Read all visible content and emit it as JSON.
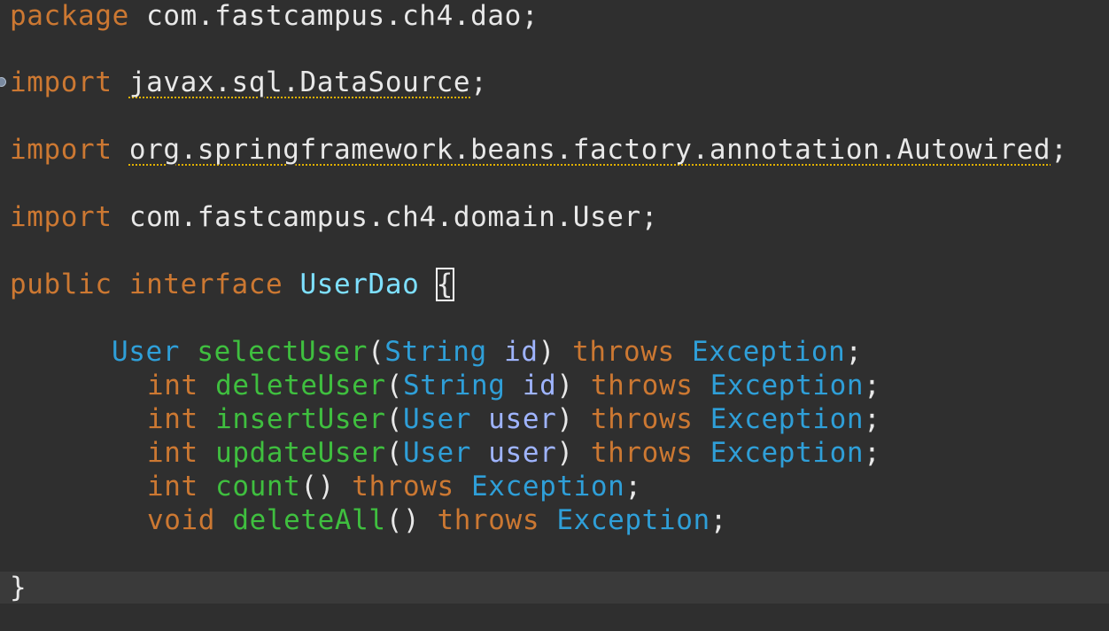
{
  "code": {
    "lines": [
      [
        {
          "text": "package",
          "style": "kw"
        },
        {
          "text": " com.fastcampus.ch4.dao;",
          "style": "plain"
        }
      ],
      [
        {
          "text": "import",
          "style": "kw"
        },
        {
          "text": " ",
          "style": "plain"
        },
        {
          "text": "javax.sql.DataSource",
          "style": "unused"
        },
        {
          "text": ";",
          "style": "plain"
        }
      ],
      [
        {
          "text": "import",
          "style": "kw"
        },
        {
          "text": " ",
          "style": "plain"
        },
        {
          "text": "org.springframework.beans.factory.annotation.Autowired",
          "style": "unused"
        },
        {
          "text": ";",
          "style": "plain"
        }
      ],
      [
        {
          "text": "import",
          "style": "kw"
        },
        {
          "text": " com.fastcampus.ch4.domain.User;",
          "style": "plain"
        }
      ],
      [
        {
          "text": "public",
          "style": "kw"
        },
        {
          "text": " ",
          "style": "plain"
        },
        {
          "text": "interface",
          "style": "kw"
        },
        {
          "text": " ",
          "style": "plain"
        },
        {
          "text": "UserDao",
          "style": "cls"
        },
        {
          "text": " ",
          "style": "plain"
        },
        {
          "text": "{",
          "style": "brace-box"
        }
      ],
      [
        {
          "text": "User",
          "style": "type"
        },
        {
          "text": " ",
          "style": "plain"
        },
        {
          "text": "selectUser",
          "style": "method"
        },
        {
          "text": "(",
          "style": "plain"
        },
        {
          "text": "String",
          "style": "type"
        },
        {
          "text": " ",
          "style": "plain"
        },
        {
          "text": "id",
          "style": "param"
        },
        {
          "text": ") ",
          "style": "plain"
        },
        {
          "text": "throws",
          "style": "kw"
        },
        {
          "text": " ",
          "style": "plain"
        },
        {
          "text": "Exception",
          "style": "type"
        },
        {
          "text": ";",
          "style": "plain"
        }
      ],
      [
        {
          "text": "int",
          "style": "kw"
        },
        {
          "text": " ",
          "style": "plain"
        },
        {
          "text": "deleteUser",
          "style": "method"
        },
        {
          "text": "(",
          "style": "plain"
        },
        {
          "text": "String",
          "style": "type"
        },
        {
          "text": " ",
          "style": "plain"
        },
        {
          "text": "id",
          "style": "param"
        },
        {
          "text": ") ",
          "style": "plain"
        },
        {
          "text": "throws",
          "style": "kw"
        },
        {
          "text": " ",
          "style": "plain"
        },
        {
          "text": "Exception",
          "style": "type"
        },
        {
          "text": ";",
          "style": "plain"
        }
      ],
      [
        {
          "text": "int",
          "style": "kw"
        },
        {
          "text": " ",
          "style": "plain"
        },
        {
          "text": "insertUser",
          "style": "method"
        },
        {
          "text": "(",
          "style": "plain"
        },
        {
          "text": "User",
          "style": "type"
        },
        {
          "text": " ",
          "style": "plain"
        },
        {
          "text": "user",
          "style": "param"
        },
        {
          "text": ") ",
          "style": "plain"
        },
        {
          "text": "throws",
          "style": "kw"
        },
        {
          "text": " ",
          "style": "plain"
        },
        {
          "text": "Exception",
          "style": "type"
        },
        {
          "text": ";",
          "style": "plain"
        }
      ],
      [
        {
          "text": "int",
          "style": "kw"
        },
        {
          "text": " ",
          "style": "plain"
        },
        {
          "text": "updateUser",
          "style": "method"
        },
        {
          "text": "(",
          "style": "plain"
        },
        {
          "text": "User",
          "style": "type"
        },
        {
          "text": " ",
          "style": "plain"
        },
        {
          "text": "user",
          "style": "param"
        },
        {
          "text": ") ",
          "style": "plain"
        },
        {
          "text": "throws",
          "style": "kw"
        },
        {
          "text": " ",
          "style": "plain"
        },
        {
          "text": "Exception",
          "style": "type"
        },
        {
          "text": ";",
          "style": "plain"
        }
      ],
      [
        {
          "text": "int",
          "style": "kw"
        },
        {
          "text": " ",
          "style": "plain"
        },
        {
          "text": "count",
          "style": "method"
        },
        {
          "text": "() ",
          "style": "plain"
        },
        {
          "text": "throws",
          "style": "kw"
        },
        {
          "text": " ",
          "style": "plain"
        },
        {
          "text": "Exception",
          "style": "type"
        },
        {
          "text": ";",
          "style": "plain"
        }
      ],
      [
        {
          "text": "void",
          "style": "kw"
        },
        {
          "text": " ",
          "style": "plain"
        },
        {
          "text": "deleteAll",
          "style": "method"
        },
        {
          "text": "() ",
          "style": "plain"
        },
        {
          "text": "throws",
          "style": "kw"
        },
        {
          "text": " ",
          "style": "plain"
        },
        {
          "text": "Exception",
          "style": "type"
        },
        {
          "text": ";",
          "style": "plain"
        }
      ],
      [
        {
          "text": "}",
          "style": "plain"
        }
      ]
    ]
  },
  "colors": {
    "background": "#2f2f2f",
    "current_line": "#3a3a3a",
    "keyword": "#cc7832",
    "type": "#2f9fd8",
    "method": "#3fbf3f",
    "param": "#9fb4ff",
    "class_name": "#7ee0ff",
    "warning_underline": "#e0b000"
  }
}
